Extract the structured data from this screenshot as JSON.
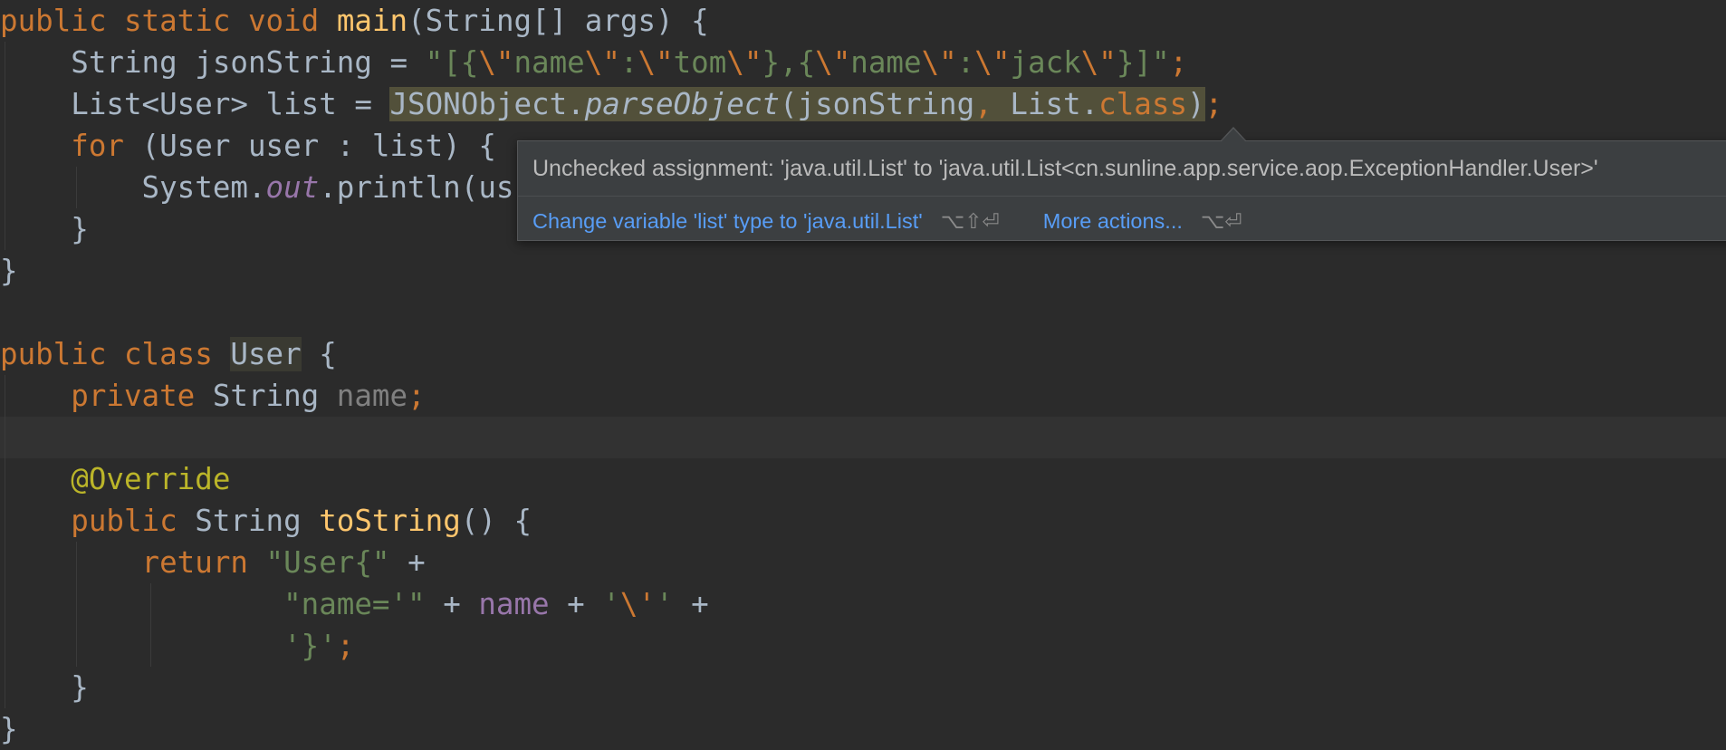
{
  "code": {
    "l1": {
      "kw1": "public",
      "kw2": "static",
      "kw3": "void",
      "fn": "main",
      "rest": "(String[] args) {"
    },
    "l2": {
      "type": "String jsonString = ",
      "s1": "\"[{",
      "e1": "\\\"",
      "s2": "name",
      "e2": "\\\"",
      "s3": ":",
      "e3": "\\\"",
      "s4": "tom",
      "e4": "\\\"",
      "s5": "},{",
      "e5": "\\\"",
      "s6": "name",
      "e6": "\\\"",
      "s7": ":",
      "e7": "\\\"",
      "s8": "jack",
      "e8": "\\\"",
      "s9": "}]\"",
      "semi": ";"
    },
    "l3": {
      "pre": "List<User> list = ",
      "obj": "JSONObject.",
      "method": "parseObject",
      "args1": "(jsonString",
      "comma": ", ",
      "cls": "List.",
      "kwclass": "class",
      "close": ")",
      "semi": ";"
    },
    "l4": {
      "kw": "for",
      "rest": " (User user : list) {"
    },
    "l5": {
      "pre": "System.",
      "field": "out",
      "rest": ".println(us"
    },
    "l6": {
      "brace": "}"
    },
    "l7": {
      "brace": "}"
    },
    "l9": {
      "kw1": "public",
      "kw2": "class",
      "name": "User",
      "rest": " {"
    },
    "l10": {
      "kw": "private",
      "type": " String ",
      "field": "name",
      "semi": ";"
    },
    "l12": {
      "anno": "@Override"
    },
    "l13": {
      "kw": "public",
      "type": " String ",
      "fn": "toString",
      "rest": "() {"
    },
    "l14": {
      "kw": "return",
      "str": "\"User{\"",
      "rest": " +"
    },
    "l15": {
      "str1": "\"name='\"",
      "op1": " + ",
      "field": "name",
      "op2": " + ",
      "str2": "'",
      "esc": "\\'",
      "str3": "'",
      "op3": " +"
    },
    "l16": {
      "str": "'}'",
      "semi": ";"
    },
    "l17": {
      "brace": "}"
    },
    "l18": {
      "brace": "}"
    }
  },
  "tooltip": {
    "message": "Unchecked assignment: 'java.util.List' to 'java.util.List<cn.sunline.app.service.aop.ExceptionHandler.User>'",
    "action1_label": "Change variable 'list' type to 'java.util.List'",
    "action1_shortcut": "⌥⇧⏎",
    "action2_label": "More actions...",
    "action2_shortcut": "⌥⏎"
  },
  "colors": {
    "background": "#2b2b2b",
    "keyword": "#cc7832",
    "function": "#ffc66d",
    "string": "#6a8759",
    "field": "#9876aa",
    "annotation": "#bbb529",
    "link": "#589df6"
  }
}
